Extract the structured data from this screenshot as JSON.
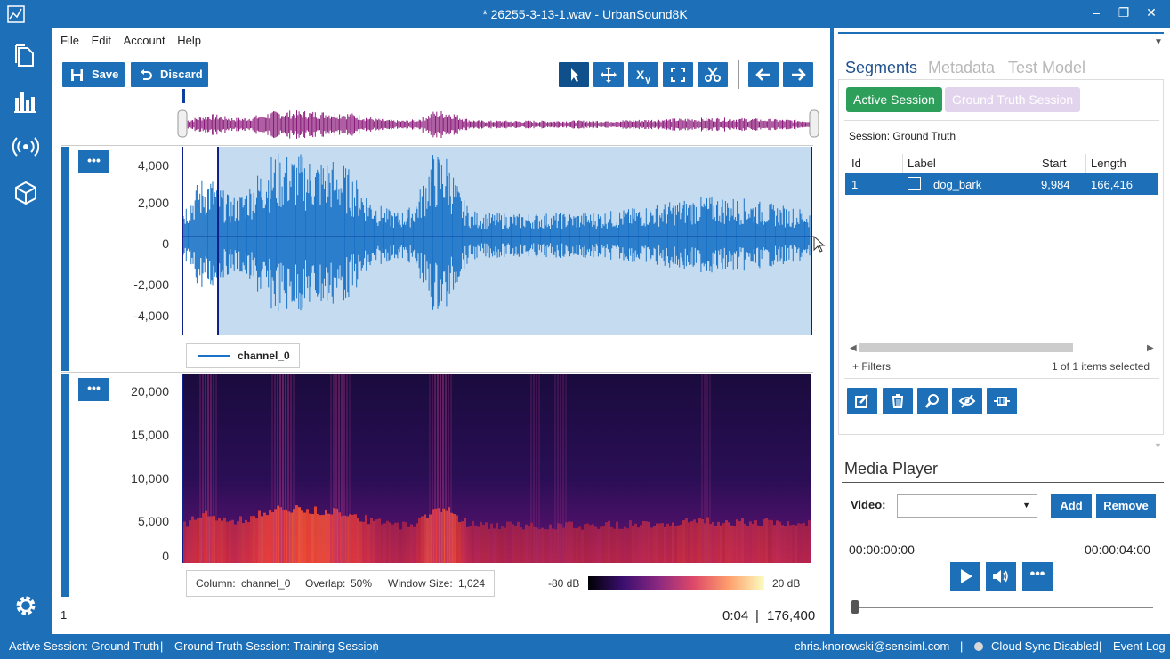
{
  "window": {
    "title": "* 26255-3-13-1.wav - UrbanSound8K"
  },
  "menu": {
    "file": "File",
    "edit": "Edit",
    "account": "Account",
    "help": "Help"
  },
  "toolbar": {
    "save_label": "Save",
    "discard_label": "Discard"
  },
  "waveform": {
    "y_ticks": [
      "4,000",
      "2,000",
      "0",
      "-2,000",
      "-4,000"
    ],
    "legend": "channel_0",
    "dots": "•••"
  },
  "spectrogram": {
    "y_ticks": [
      "20,000",
      "15,000",
      "10,000",
      "5,000",
      "0"
    ],
    "column_label": "Column:",
    "column_value": "channel_0",
    "overlap_label": "Overlap:",
    "overlap_value": "50%",
    "window_label": "Window Size:",
    "window_value": "1,024",
    "db_min": "-80 dB",
    "db_max": "20 dB",
    "dots": "•••"
  },
  "footer": {
    "page": "1",
    "time": "0:04",
    "separator": "|",
    "samples": "176,400"
  },
  "tabs": {
    "segments": "Segments",
    "metadata": "Metadata",
    "test_model": "Test Model"
  },
  "sessions": {
    "active_label": "Active Session",
    "ground_truth_label": "Ground Truth Session",
    "session_text": "Session:  Ground Truth",
    "active_color": "#2e9e5b",
    "ground_truth_color": "#e2d4ec"
  },
  "grid": {
    "headers": {
      "id": "Id",
      "label": "Label",
      "start": "Start",
      "length": "Length"
    },
    "row": {
      "id": "1",
      "label": "dog_bark",
      "start": "9,984",
      "length": "166,416"
    },
    "filters": "+ Filters",
    "selection": "1 of 1 items selected"
  },
  "media": {
    "title": "Media Player",
    "video_label": "Video:",
    "add_label": "Add",
    "remove_label": "Remove",
    "time_start": "00:00:00:00",
    "time_end": "00:00:04:00"
  },
  "status": {
    "active_session": "Active Session:  Ground Truth",
    "gt_session": "Ground Truth Session:  Training Session",
    "email": "chris.knorowski@sensiml.com",
    "cloud": "Cloud Sync Disabled",
    "event_log": "Event Log"
  },
  "colors": {
    "accent": "#1d6fb8",
    "waveform": "#1a73c7",
    "overview": "#8b1a7a",
    "selection": "#c5dcf0"
  }
}
